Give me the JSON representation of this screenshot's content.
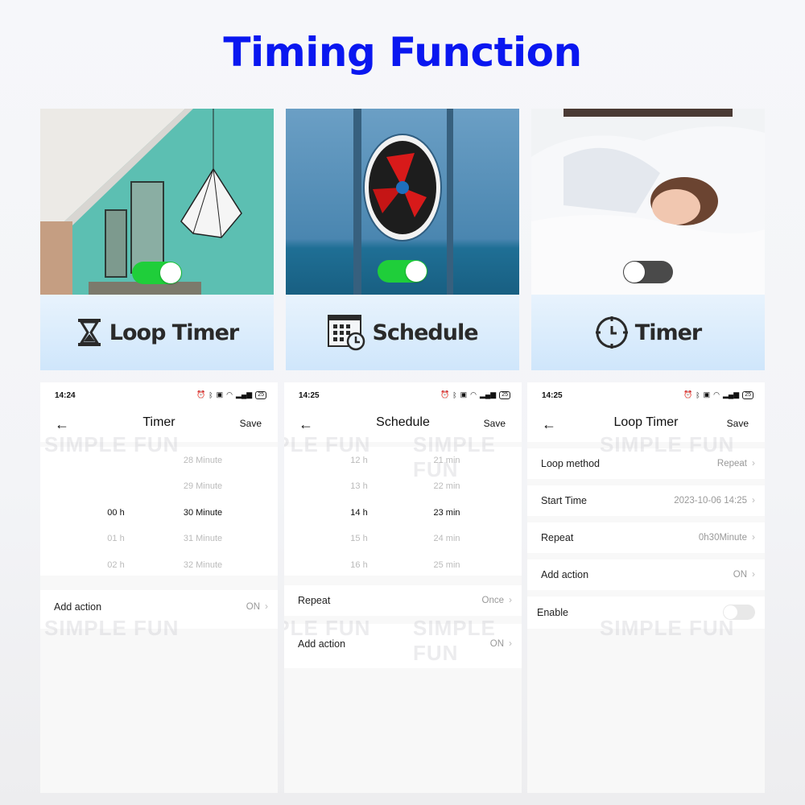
{
  "title": "Timing Function",
  "colors": {
    "title": "#0a17f0",
    "toggle_on": "#1fce3a",
    "toggle_off": "#4a4a4a",
    "banner": "#d8ebfc"
  },
  "cards": [
    {
      "label": "Loop Timer",
      "icon": "hourglass-icon",
      "photo": "room-with-pendant-lamp",
      "toggle": "on"
    },
    {
      "label": "Schedule",
      "icon": "calendar-clock-icon",
      "photo": "wall-exhaust-fan",
      "toggle": "on"
    },
    {
      "label": "Timer",
      "icon": "clock-icon",
      "photo": "woman-sleeping-in-bed",
      "toggle": "off"
    }
  ],
  "watermark": "SIMPLE FUN",
  "phones": [
    {
      "status_time": "14:24",
      "battery": "25",
      "title": "Timer",
      "save": "Save",
      "picker": {
        "hours": [
          "",
          "",
          "00 h",
          "01 h",
          "02 h"
        ],
        "minutes": [
          "28 Minute",
          "29 Minute",
          "30 Minute",
          "31 Minute",
          "32 Minute"
        ],
        "selected_index": 2
      },
      "rows": [
        {
          "label": "Add action",
          "value": "ON"
        }
      ]
    },
    {
      "status_time": "14:25",
      "battery": "25",
      "title": "Schedule",
      "save": "Save",
      "picker": {
        "hours": [
          "12 h",
          "13 h",
          "14 h",
          "15 h",
          "16 h"
        ],
        "minutes": [
          "21 min",
          "22 min",
          "23 min",
          "24 min",
          "25 min"
        ],
        "selected_index": 2
      },
      "rows": [
        {
          "label": "Repeat",
          "value": "Once"
        },
        {
          "label": "Add action",
          "value": "ON"
        }
      ]
    },
    {
      "status_time": "14:25",
      "battery": "25",
      "title": "Loop Timer",
      "save": "Save",
      "rows": [
        {
          "label": "Loop method",
          "value": "Repeat"
        },
        {
          "label": "Start Time",
          "value": "2023-10-06 14:25"
        },
        {
          "label": "Repeat",
          "value": "0h30Minute"
        },
        {
          "label": "Add action",
          "value": "ON"
        }
      ],
      "enable": {
        "label": "Enable",
        "state": "off"
      }
    }
  ]
}
